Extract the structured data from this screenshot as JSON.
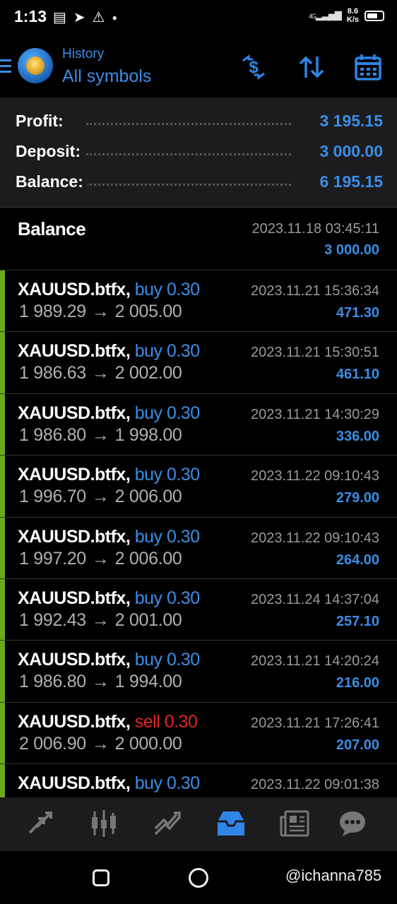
{
  "status_bar": {
    "time": "1:13",
    "net_speed_value": "8.6",
    "net_speed_unit": "K/s",
    "network": "4G"
  },
  "header": {
    "title": "History",
    "subtitle": "All symbols"
  },
  "summary": {
    "profit_label": "Profit:",
    "profit_value": "3 195.15",
    "deposit_label": "Deposit:",
    "deposit_value": "3 000.00",
    "balance_label": "Balance:",
    "balance_value": "6 195.15"
  },
  "balance_entry": {
    "title": "Balance",
    "time": "2023.11.18 03:45:11",
    "amount": "3 000.00"
  },
  "deals": [
    {
      "symbol": "XAUUSD.btfx,",
      "side": "buy 0.30",
      "open": "1 989.29",
      "close": "2 005.00",
      "time": "2023.11.21 15:36:34",
      "profit": "471.30"
    },
    {
      "symbol": "XAUUSD.btfx,",
      "side": "buy 0.30",
      "open": "1 986.63",
      "close": "2 002.00",
      "time": "2023.11.21 15:30:51",
      "profit": "461.10"
    },
    {
      "symbol": "XAUUSD.btfx,",
      "side": "buy 0.30",
      "open": "1 986.80",
      "close": "1 998.00",
      "time": "2023.11.21 14:30:29",
      "profit": "336.00"
    },
    {
      "symbol": "XAUUSD.btfx,",
      "side": "buy 0.30",
      "open": "1 996.70",
      "close": "2 006.00",
      "time": "2023.11.22 09:10:43",
      "profit": "279.00"
    },
    {
      "symbol": "XAUUSD.btfx,",
      "side": "buy 0.30",
      "open": "1 997.20",
      "close": "2 006.00",
      "time": "2023.11.22 09:10:43",
      "profit": "264.00"
    },
    {
      "symbol": "XAUUSD.btfx,",
      "side": "buy 0.30",
      "open": "1 992.43",
      "close": "2 001.00",
      "time": "2023.11.24 14:37:04",
      "profit": "257.10"
    },
    {
      "symbol": "XAUUSD.btfx,",
      "side": "buy 0.30",
      "open": "1 986.80",
      "close": "1 994.00",
      "time": "2023.11.21 14:20:24",
      "profit": "216.00"
    },
    {
      "symbol": "XAUUSD.btfx,",
      "side": "sell 0.30",
      "open": "2 006.90",
      "close": "2 000.00",
      "time": "2023.11.21 17:26:41",
      "profit": "207.00"
    },
    {
      "symbol": "XAUUSD.btfx,",
      "side": "buy 0.30",
      "open": "",
      "close": "",
      "time": "2023.11.22 09:01:38",
      "profit": ""
    }
  ],
  "arrow_glyph": "→",
  "watermark": "@ichanna785",
  "colors": {
    "accent": "#3a8ee6",
    "buy": "#3a8ee6",
    "sell": "#e02424",
    "deal_bar": "#6aaa1e"
  },
  "icons": {
    "header": [
      "dollar-exchange-icon",
      "sort-icon",
      "calendar-icon"
    ],
    "bottom_nav": [
      "quotes-icon",
      "chart-icon",
      "trade-icon",
      "history-icon",
      "news-icon",
      "messages-icon"
    ]
  }
}
